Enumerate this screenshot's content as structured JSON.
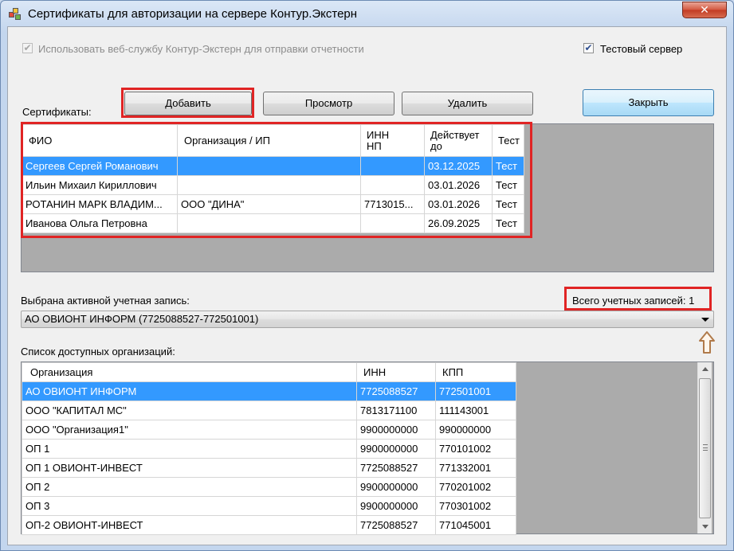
{
  "window": {
    "title": "Сертификаты для авторизации на сервере Контур.Экстерн",
    "close_glyph": "✕"
  },
  "options": {
    "use_webservice_label": "Использовать веб-службу Контур-Экстерн для отправки отчетности",
    "use_webservice_checked": true,
    "use_webservice_enabled": false,
    "test_server_label": "Тестовый сервер",
    "test_server_checked": true,
    "check_glyph": "✔"
  },
  "certificates": {
    "label": "Сертификаты:",
    "buttons": {
      "add": "Добавить",
      "view": "Просмотр",
      "delete": "Удалить",
      "close": "Закрыть"
    },
    "columns": {
      "fio": "ФИО",
      "org": "Организация / ИП",
      "inn_line1": "ИНН",
      "inn_line2": "НП",
      "valid_line1": "Действует",
      "valid_line2": "до",
      "test": "Тест"
    },
    "rows": [
      {
        "fio": "Сергеев Сергей Романович",
        "org": "",
        "inn": "",
        "valid": "03.12.2025",
        "test": "Тест",
        "selected": true
      },
      {
        "fio": "Ильин Михаил Кириллович",
        "org": "",
        "inn": "",
        "valid": "03.01.2026",
        "test": "Тест",
        "selected": false
      },
      {
        "fio": "РОТАНИН МАРК ВЛАДИМ...",
        "org": "ООО \"ДИНА\"",
        "inn": "7713015...",
        "valid": "03.01.2026",
        "test": "Тест",
        "selected": false
      },
      {
        "fio": "Иванова Ольга Петровна",
        "org": "",
        "inn": "",
        "valid": "26.09.2025",
        "test": "Тест",
        "selected": false
      }
    ]
  },
  "account": {
    "label": "Выбрана активной учетная запись:",
    "total_label": "Всего учетных записей: 1",
    "selected": "АО ОВИОНТ ИНФОРМ (7725088527-772501001)"
  },
  "organizations": {
    "label": "Список доступных организаций:",
    "columns": {
      "name": "Организация",
      "inn": "ИНН",
      "kpp": "КПП"
    },
    "rows": [
      {
        "name": "АО ОВИОНТ ИНФОРМ",
        "inn": "7725088527",
        "kpp": "772501001",
        "selected": true
      },
      {
        "name": "ООО \"КАПИТАЛ МС\"",
        "inn": "7813171100",
        "kpp": "111143001",
        "selected": false
      },
      {
        "name": "ООО \"Организация1\"",
        "inn": "9900000000",
        "kpp": "990000000",
        "selected": false
      },
      {
        "name": "ОП 1",
        "inn": "9900000000",
        "kpp": "770101002",
        "selected": false
      },
      {
        "name": "ОП 1 ОВИОНТ-ИНВЕСТ",
        "inn": "7725088527",
        "kpp": "771332001",
        "selected": false
      },
      {
        "name": "ОП 2",
        "inn": "9900000000",
        "kpp": "770201002",
        "selected": false
      },
      {
        "name": "ОП 3",
        "inn": "9900000000",
        "kpp": "770301002",
        "selected": false
      },
      {
        "name": "ОП-2 ОВИОНТ-ИНВЕСТ",
        "inn": "7725088527",
        "kpp": "771045001",
        "selected": false
      }
    ]
  },
  "colors": {
    "selection": "#3399ff",
    "highlight_frame": "#e02424",
    "hint_arrow": "#b07a4a"
  }
}
